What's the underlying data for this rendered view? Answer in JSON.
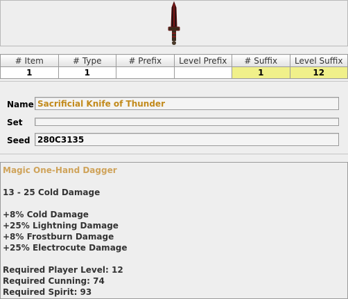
{
  "item_icon": "dagger-icon",
  "columns": [
    {
      "header": "# Item",
      "value": "1",
      "highlight": false
    },
    {
      "header": "# Type",
      "value": "1",
      "highlight": false
    },
    {
      "header": "# Prefix",
      "value": "",
      "highlight": false
    },
    {
      "header": "Level Prefix",
      "value": "",
      "highlight": false
    },
    {
      "header": "# Suffix",
      "value": "1",
      "highlight": true
    },
    {
      "header": "Level Suffix",
      "value": "12",
      "highlight": true
    }
  ],
  "form": {
    "name_label": "Name",
    "name_value": "Sacrificial Knife of Thunder",
    "set_label": "Set",
    "set_value": "",
    "seed_label": "Seed",
    "seed_value": "280C3135"
  },
  "description": {
    "type_line": "Magic One-Hand Dagger",
    "base_damage": "13 - 25 Cold Damage",
    "modifiers": [
      "+8% Cold Damage",
      "+25% Lightning Damage",
      "+8% Frostburn Damage",
      "+25% Electrocute Damage"
    ],
    "requirements": [
      "Required Player Level: 12",
      "Required Cunning: 74",
      "Required Spirit: 93"
    ]
  },
  "colors": {
    "name_text": "#c28a1c",
    "type_text": "#cfa35a",
    "highlight_cell": "#f0f08a"
  }
}
